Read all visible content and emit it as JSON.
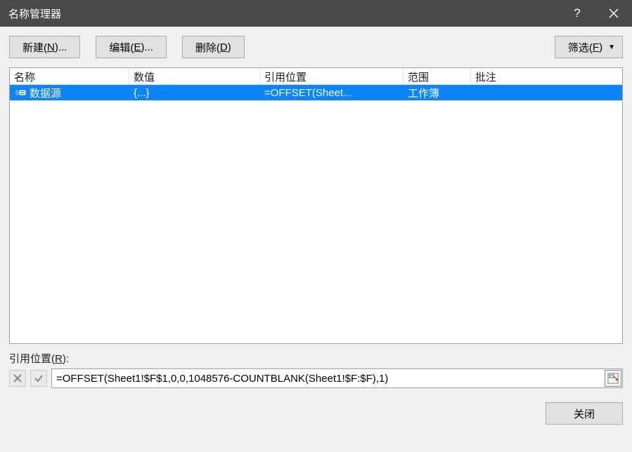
{
  "title": "名称管理器",
  "toolbar": {
    "new_label": "新建(",
    "new_key": "N",
    "new_tail": ")...",
    "edit_label": "编辑(",
    "edit_key": "E",
    "edit_tail": ")...",
    "delete_label": "删除(",
    "delete_key": "D",
    "delete_tail": ")",
    "filter_label": "筛选(",
    "filter_key": "F",
    "filter_tail": ")"
  },
  "columns": {
    "name": "名称",
    "value": "数值",
    "ref": "引用位置",
    "scope": "范围",
    "note": "批注"
  },
  "rows": [
    {
      "name": "数据源",
      "value": "{...}",
      "ref": "=OFFSET(Sheet...",
      "scope": "工作簿",
      "note": ""
    }
  ],
  "refersto": {
    "label": "引用位置(",
    "key": "R",
    "tail": "):",
    "value": "=OFFSET(Sheet1!$F$1,0,0,1048576-COUNTBLANK(Sheet1!$F:$F),1)"
  },
  "footer": {
    "close_label": "关闭"
  }
}
